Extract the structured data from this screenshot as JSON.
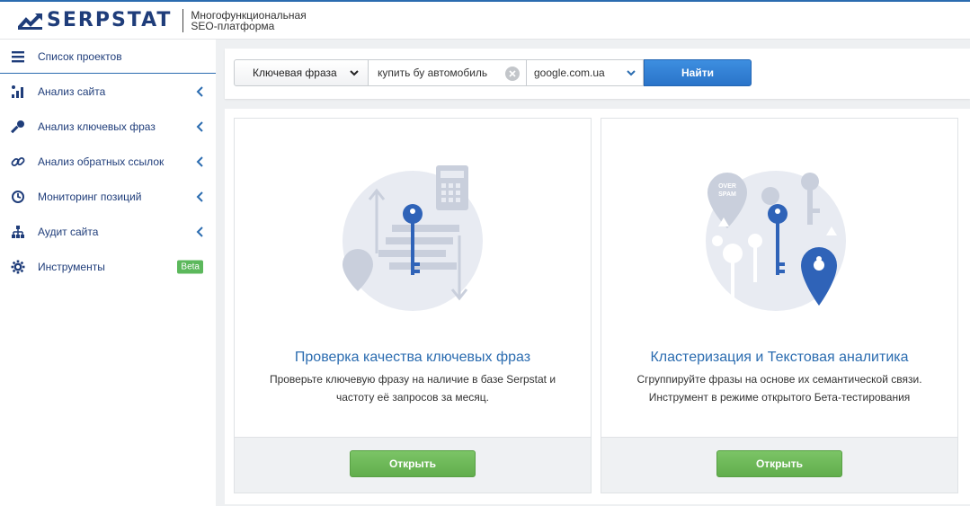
{
  "header": {
    "logo_text": "SERPSTAT",
    "tagline_line1": "Многофункциональная",
    "tagline_line2": "SEO-платформа"
  },
  "sidebar": {
    "items": [
      {
        "label": "Список проектов",
        "icon": "menu-icon"
      },
      {
        "label": "Анализ сайта",
        "icon": "chart-icon"
      },
      {
        "label": "Анализ ключевых фраз",
        "icon": "key-icon"
      },
      {
        "label": "Анализ обратных ссылок",
        "icon": "link-icon"
      },
      {
        "label": "Мониторинг позиций",
        "icon": "clock-icon"
      },
      {
        "label": "Аудит сайта",
        "icon": "sitemap-icon"
      },
      {
        "label": "Инструменты",
        "icon": "gear-icon",
        "badge": "Beta"
      }
    ]
  },
  "search": {
    "type_selected": "Ключевая фраза",
    "query_value": "купить бу автомобиль",
    "engine_selected": "google.com.ua",
    "submit_label": "Найти"
  },
  "cards": [
    {
      "title": "Проверка качества ключевых фраз",
      "desc_line1": "Проверьте ключевую фразу на наличие в базе Serpstat и",
      "desc_line2": "частоту её запросов за месяц.",
      "button": "Открыть"
    },
    {
      "title": "Кластеризация и Текстовая аналитика",
      "desc_line1": "Сгруппируйте фразы на основе их семантической связи.",
      "desc_line2": "Инструмент в режиме открытого Бета-тестирования",
      "button": "Открыть",
      "illus_tag": "OVER SPAM"
    }
  ],
  "colors": {
    "brand": "#1f3d7a",
    "accent": "#2b6cb0",
    "green": "#61ad4c",
    "illus": "#e6e9f0",
    "illus_dark": "#c9cfdc",
    "key_blue": "#2f63b8"
  }
}
